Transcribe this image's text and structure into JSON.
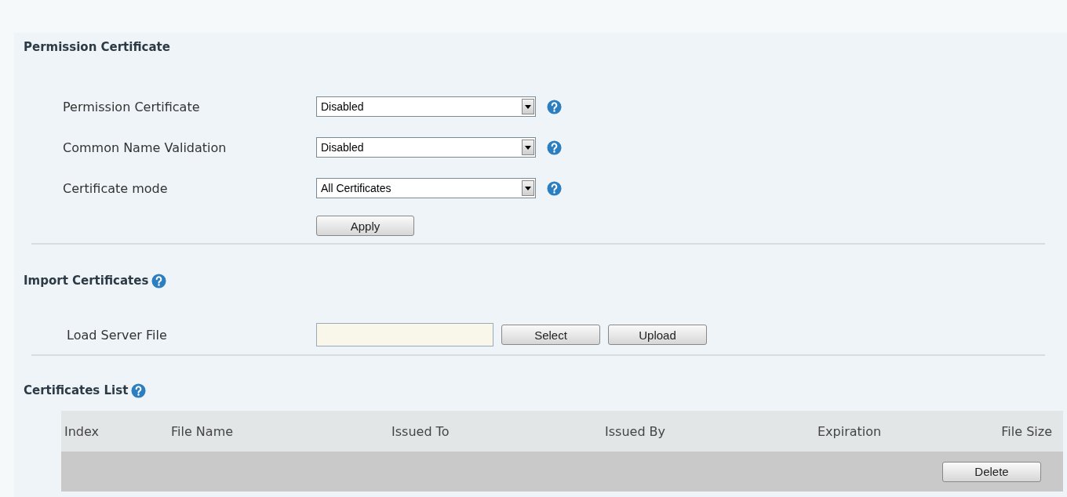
{
  "sections": [
    {
      "kind": "form",
      "title": "Permission Certificate",
      "help": false,
      "fields": [
        {
          "label": "Permission Certificate",
          "value": "Disabled"
        },
        {
          "label": "Common Name Validation",
          "value": "Disabled"
        },
        {
          "label": "Certificate mode",
          "value": "All Certificates"
        }
      ],
      "button": "Apply"
    },
    {
      "kind": "upload",
      "title": "Import Certificates",
      "help": true,
      "label": "Load Server File",
      "buttons": [
        "Select",
        "Upload"
      ]
    },
    {
      "kind": "table",
      "title": "Certificates List",
      "help": true,
      "columns": [
        "Index",
        "File Name",
        "Issued To",
        "Issued By",
        "Expiration",
        "File Size"
      ],
      "row_button": "Delete"
    }
  ]
}
